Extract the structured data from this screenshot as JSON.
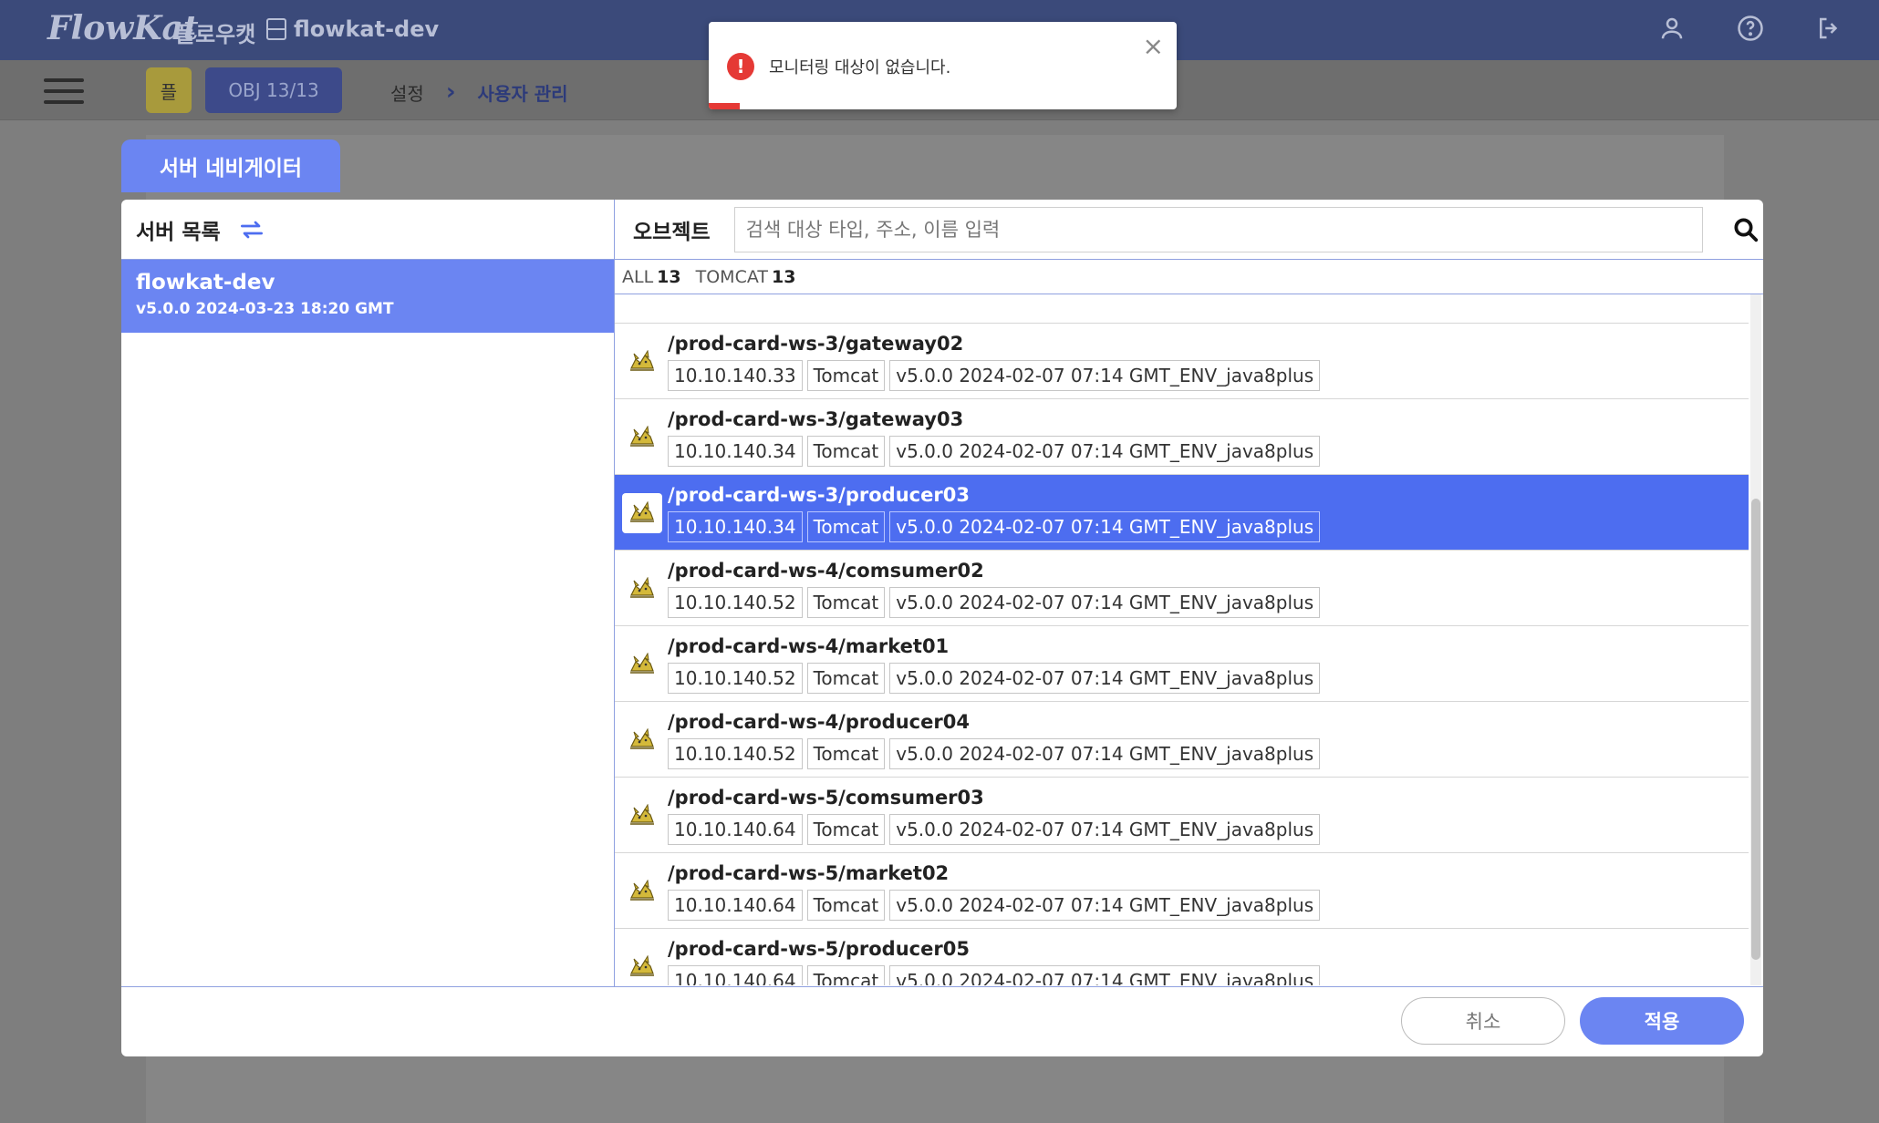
{
  "header": {
    "logo": "FlowKat",
    "brand_kr": "플로우캣",
    "server_name": "flowkat-dev"
  },
  "subbar": {
    "user_badge": "플",
    "obj_button": "OBJ 13/13",
    "breadcrumb": [
      "설정",
      "사용자 관리"
    ]
  },
  "modal": {
    "tab_label": "서버 네비게이터",
    "left": {
      "title": "서버 목록",
      "servers": [
        {
          "name": "flowkat-dev",
          "version": "v5.0.0 2024-03-23 18:20 GMT"
        }
      ]
    },
    "right": {
      "title": "오브젝트",
      "search_placeholder": "검색 대상 타입, 주소, 이름 입력",
      "filters": [
        {
          "label": "ALL",
          "count": "13"
        },
        {
          "label": "TOMCAT",
          "count": "13"
        }
      ],
      "objects": [
        {
          "name": "/prod-card-ws-3/gateway02",
          "ip": "10.10.140.33",
          "type": "Tomcat",
          "version": "v5.0.0 2024-02-07 07:14 GMT_ENV_java8plus",
          "selected": false
        },
        {
          "name": "/prod-card-ws-3/gateway03",
          "ip": "10.10.140.34",
          "type": "Tomcat",
          "version": "v5.0.0 2024-02-07 07:14 GMT_ENV_java8plus",
          "selected": false
        },
        {
          "name": "/prod-card-ws-3/producer03",
          "ip": "10.10.140.34",
          "type": "Tomcat",
          "version": "v5.0.0 2024-02-07 07:14 GMT_ENV_java8plus",
          "selected": true
        },
        {
          "name": "/prod-card-ws-4/comsumer02",
          "ip": "10.10.140.52",
          "type": "Tomcat",
          "version": "v5.0.0 2024-02-07 07:14 GMT_ENV_java8plus",
          "selected": false
        },
        {
          "name": "/prod-card-ws-4/market01",
          "ip": "10.10.140.52",
          "type": "Tomcat",
          "version": "v5.0.0 2024-02-07 07:14 GMT_ENV_java8plus",
          "selected": false
        },
        {
          "name": "/prod-card-ws-4/producer04",
          "ip": "10.10.140.52",
          "type": "Tomcat",
          "version": "v5.0.0 2024-02-07 07:14 GMT_ENV_java8plus",
          "selected": false
        },
        {
          "name": "/prod-card-ws-5/comsumer03",
          "ip": "10.10.140.64",
          "type": "Tomcat",
          "version": "v5.0.0 2024-02-07 07:14 GMT_ENV_java8plus",
          "selected": false
        },
        {
          "name": "/prod-card-ws-5/market02",
          "ip": "10.10.140.64",
          "type": "Tomcat",
          "version": "v5.0.0 2024-02-07 07:14 GMT_ENV_java8plus",
          "selected": false
        },
        {
          "name": "/prod-card-ws-5/producer05",
          "ip": "10.10.140.64",
          "type": "Tomcat",
          "version": "v5.0.0 2024-02-07 07:14 GMT_ENV_java8plus",
          "selected": false
        }
      ]
    },
    "footer": {
      "cancel_label": "취소",
      "apply_label": "적용"
    }
  },
  "toast": {
    "message": "모니터링 대상이 없습니다.",
    "close_label": "×"
  },
  "colors": {
    "accent": "#6b85f2",
    "selected_row": "#4d6df0",
    "header": "#3b4a7a",
    "error": "#e53935"
  }
}
